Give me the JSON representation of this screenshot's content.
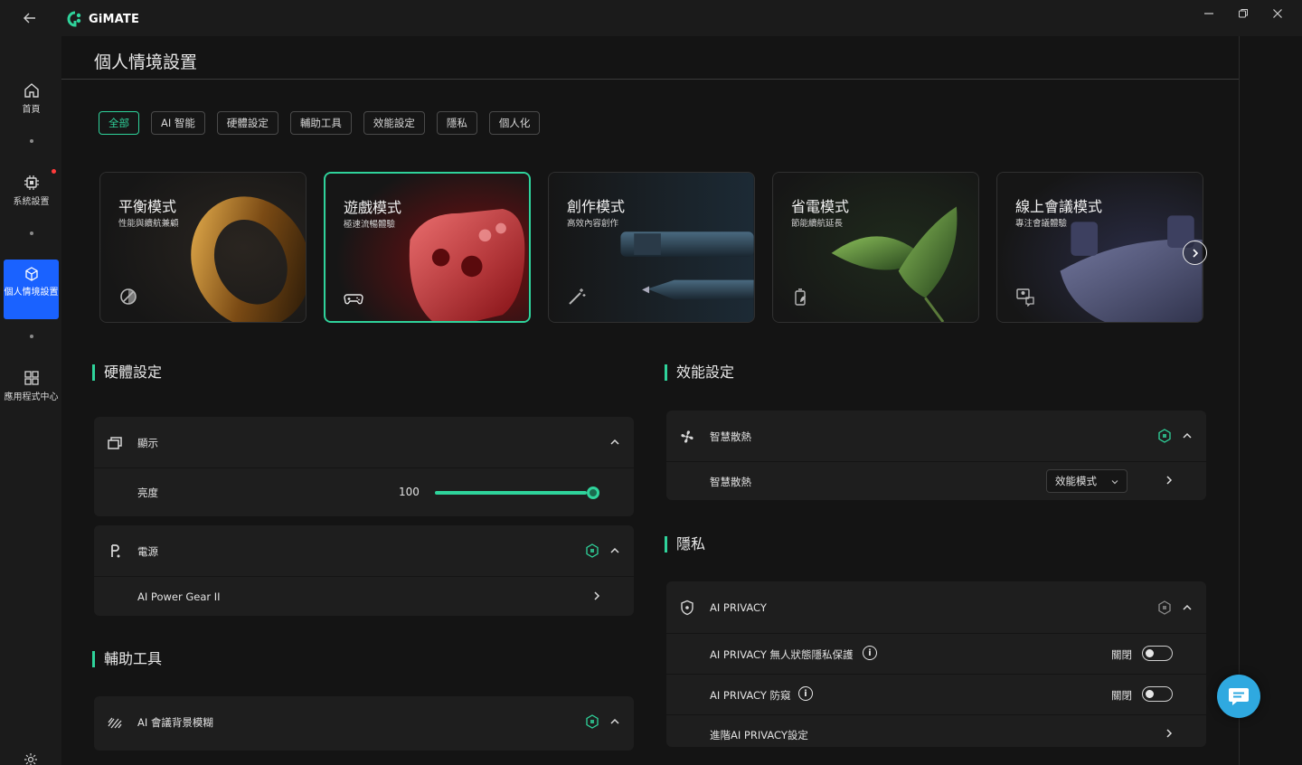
{
  "app": {
    "name": "GiMATE"
  },
  "window_controls": [
    "minimize",
    "restore",
    "close"
  ],
  "sidebar": {
    "items": [
      {
        "label": "首頁",
        "icon": "home-icon"
      },
      {
        "label": "系統設置",
        "icon": "chip-icon",
        "badge": "red-dot"
      },
      {
        "label": "個人情境設置",
        "icon": "cube-icon",
        "active": true
      },
      {
        "label": "應用程式中心",
        "icon": "grid-icon"
      }
    ]
  },
  "page": {
    "title": "個人情境設置"
  },
  "tabs": [
    {
      "label": "全部",
      "active": true
    },
    {
      "label": "AI 智能"
    },
    {
      "label": "硬體設定"
    },
    {
      "label": "輔助工具"
    },
    {
      "label": "效能設定"
    },
    {
      "label": "隱私"
    },
    {
      "label": "個人化"
    }
  ],
  "cards": [
    {
      "title": "平衡模式",
      "subtitle": "性能與續航兼顧",
      "icon": "balance-icon"
    },
    {
      "title": "遊戲模式",
      "subtitle": "極速流暢體驗",
      "icon": "gamepad-icon",
      "active": true
    },
    {
      "title": "創作模式",
      "subtitle": "高效內容創作",
      "icon": "magic-wand-icon"
    },
    {
      "title": "省電模式",
      "subtitle": "節能續航延長",
      "icon": "battery-leaf-icon"
    },
    {
      "title": "線上會議模式",
      "subtitle": "專注會議體驗",
      "icon": "meeting-icon"
    }
  ],
  "hardware": {
    "title": "硬體設定",
    "display": {
      "label": "顯示",
      "brightness_label": "亮度",
      "brightness_value": "100",
      "brightness_fraction": 1.0
    },
    "power": {
      "label": "電源",
      "gear_label": "AI Power Gear II"
    }
  },
  "assist": {
    "title": "輔助工具",
    "blur_label": "AI 會議背景模糊"
  },
  "performance": {
    "title": "效能設定",
    "fan": {
      "label": "智慧散熱",
      "row_label": "智慧散熱",
      "selected": "效能模式"
    }
  },
  "privacy": {
    "title": "隱私",
    "header": "AI PRIVACY",
    "items": [
      {
        "label": "AI PRIVACY 無人狀態隱私保護",
        "state": "關閉"
      },
      {
        "label": "AI PRIVACY 防窺",
        "state": "關閉"
      }
    ],
    "advanced": "進階AI PRIVACY設定"
  },
  "colors": {
    "accent": "#2fd39b",
    "active_nav": "#1a62ff",
    "chat": "#2fa9e0"
  }
}
